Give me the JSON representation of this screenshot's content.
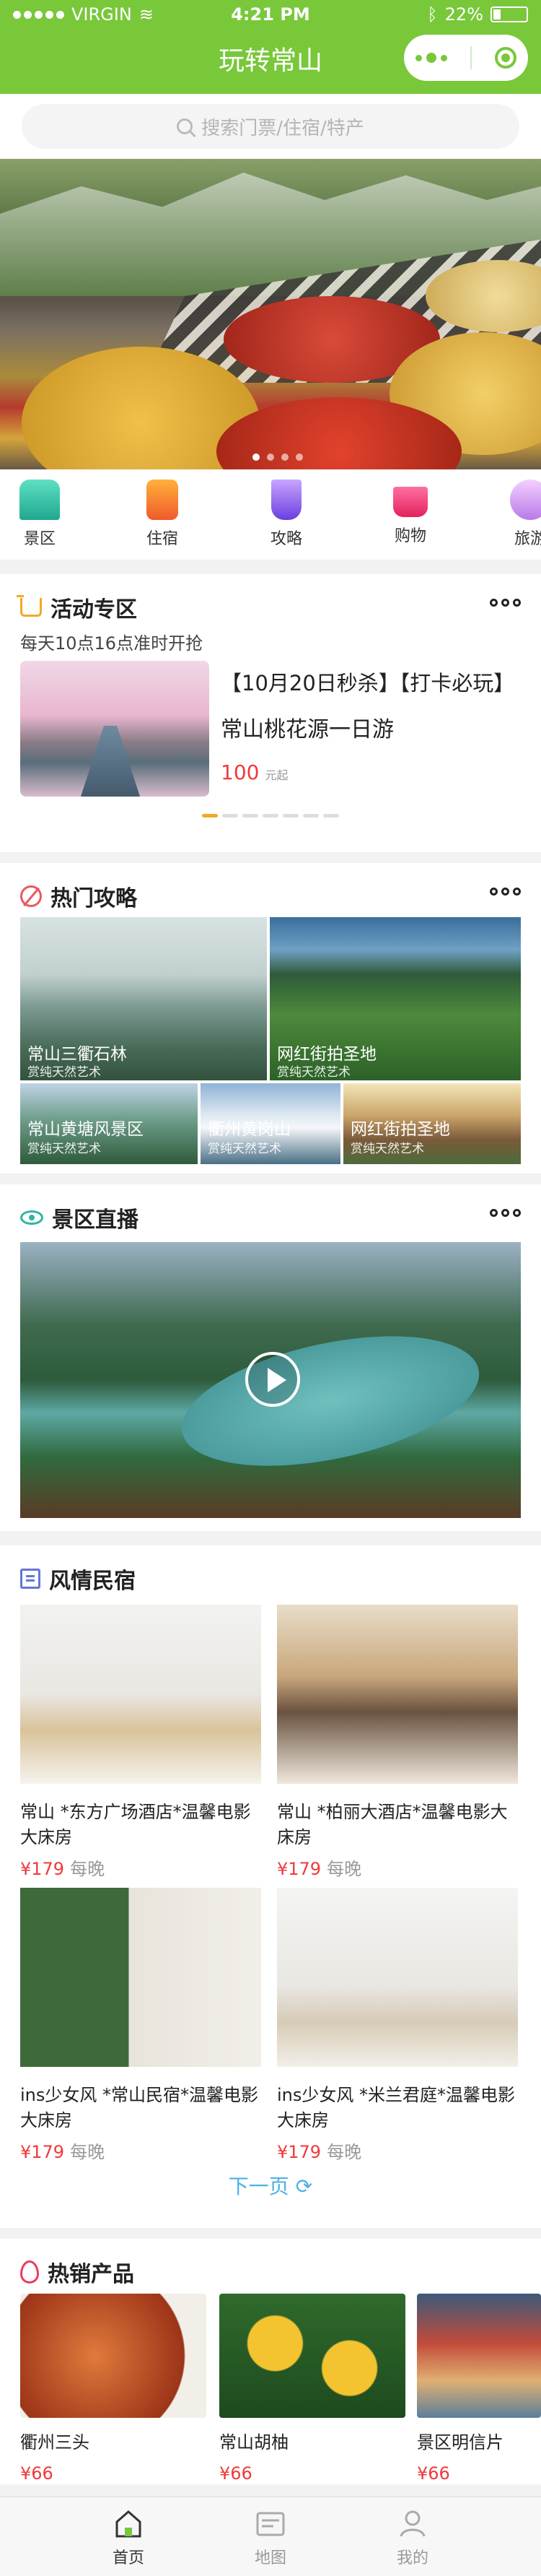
{
  "status": {
    "carrier": "VIRGIN",
    "time": "4:21 PM",
    "battery": "22%"
  },
  "nav": {
    "title": "玩转常山"
  },
  "search": {
    "placeholder": "搜索门票/住宿/特产"
  },
  "categories": [
    {
      "label": "景区",
      "icon": "castle-icon",
      "color": "#2fc3a8"
    },
    {
      "label": "住宿",
      "icon": "hotel-icon",
      "color": "#f37b2b"
    },
    {
      "label": "攻略",
      "icon": "drink-icon",
      "color": "#8b5ee8"
    },
    {
      "label": "购物",
      "icon": "cart-icon",
      "color": "#ee3a7a"
    },
    {
      "label": "旅游",
      "icon": "travel-icon",
      "color": "#b97ae8"
    }
  ],
  "activity": {
    "title": "活动专区",
    "subtitle": "每天10点16点准时开抢",
    "tag": "【10月20日秒杀】【打卡必玩】",
    "name": "常山桃花源一日游",
    "price": "100",
    "price_unit": "元起"
  },
  "guides": {
    "title": "热门攻略",
    "tiles": [
      {
        "name": "常山三衢石林",
        "sub": "赏纯天然艺术"
      },
      {
        "name": "网红街拍圣地",
        "sub": "赏纯天然艺术"
      },
      {
        "name": "常山黄塘风景区",
        "sub": "赏纯天然艺术"
      },
      {
        "name": "衢州黄岗山",
        "sub": "赏纯天然艺术"
      },
      {
        "name": "网红街拍圣地",
        "sub": "赏纯天然艺术"
      }
    ]
  },
  "live": {
    "title": "景区直播"
  },
  "homestay": {
    "title": "风情民宿",
    "items": [
      {
        "name": "常山 *东方广场酒店*温馨电影大床房",
        "price": "¥179",
        "unit": "每晚"
      },
      {
        "name": "常山 *柏丽大酒店*温馨电影大床房",
        "price": "¥179",
        "unit": "每晚"
      },
      {
        "name": "ins少女风 *常山民宿*温馨电影大床房",
        "price": "¥179",
        "unit": "每晚"
      },
      {
        "name": "ins少女风 *米兰君庭*温馨电影大床房",
        "price": "¥179",
        "unit": "每晚"
      }
    ],
    "next_page": "下一页"
  },
  "products": {
    "title": "热销产品",
    "items": [
      {
        "name": "衢州三头",
        "price": "¥66"
      },
      {
        "name": "常山胡柚",
        "price": "¥66"
      },
      {
        "name": "景区明信片",
        "price": "¥66"
      }
    ]
  },
  "tabbar": [
    {
      "label": "首页",
      "icon": "home-icon"
    },
    {
      "label": "地图",
      "icon": "map-icon"
    },
    {
      "label": "我的",
      "icon": "user-icon"
    }
  ],
  "colors": {
    "brand": "#78c83a",
    "price": "#ee3a3a",
    "link": "#4bb1e6"
  }
}
